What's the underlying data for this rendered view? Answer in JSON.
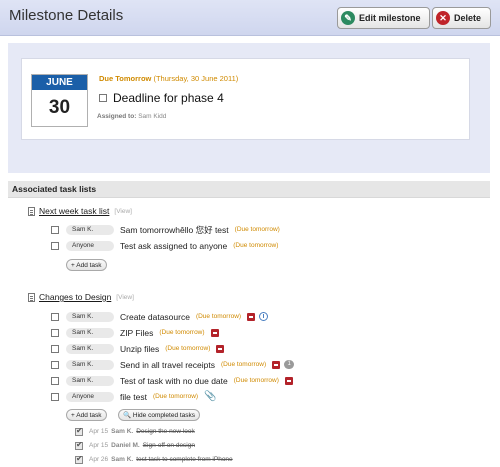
{
  "header": {
    "title": "Milestone Details",
    "edit_label": "Edit milestone",
    "delete_label": "Delete"
  },
  "milestone": {
    "month": "JUNE",
    "day": "30",
    "due_label": "Due Tomorrow",
    "due_date": "(Thursday, 30 June 2011)",
    "title": "Deadline for phase 4",
    "assigned_label": "Assigned to:",
    "assigned_name": "Sam Kidd"
  },
  "section_title": "Associated task lists",
  "lists": [
    {
      "title": "Next week task list",
      "view": "[View]",
      "tasks": [
        {
          "assignee": "Sam K.",
          "title": "Sam tomorrowhêllo 您好 test",
          "due": "(Due tomorrow)"
        },
        {
          "assignee": "Anyone",
          "title": "Test ask assigned to anyone",
          "due": "(Due tomorrow)"
        }
      ],
      "add_task": "+ Add task"
    },
    {
      "title": "Changes to Design",
      "view": "[View]",
      "tasks": [
        {
          "assignee": "Sam K.",
          "title": "Create datasource",
          "due": "(Due tomorrow)"
        },
        {
          "assignee": "Sam K.",
          "title": "ZIP Files",
          "due": "(Due tomorrow)"
        },
        {
          "assignee": "Sam K.",
          "title": "Unzip files",
          "due": "(Due tomorrow)"
        },
        {
          "assignee": "Sam K.",
          "title": "Send in all travel receipts",
          "due": "(Due tomorrow)",
          "comments": "1"
        },
        {
          "assignee": "Sam K.",
          "title": "Test of task with no due date",
          "due": "(Due tomorrow)"
        },
        {
          "assignee": "Anyone",
          "title": "file test",
          "due": "(Due tomorrow)"
        }
      ],
      "add_task": "+ Add task",
      "hide_completed": "Hide completed tasks",
      "completed": [
        {
          "date": "Apr 15",
          "who": "Sam K.",
          "title": "Design the new look"
        },
        {
          "date": "Apr 15",
          "who": "Daniel M.",
          "title": "Sign-off on design"
        },
        {
          "date": "Apr 26",
          "who": "Sam K.",
          "title": "test task to complete from iPhone"
        }
      ]
    }
  ],
  "colors": {
    "accent": "#1b5fa8",
    "due": "#d08a00",
    "lock": "#b3232a",
    "header_bg": "#dfe4f5",
    "panel_bg": "#e6e9f6"
  }
}
